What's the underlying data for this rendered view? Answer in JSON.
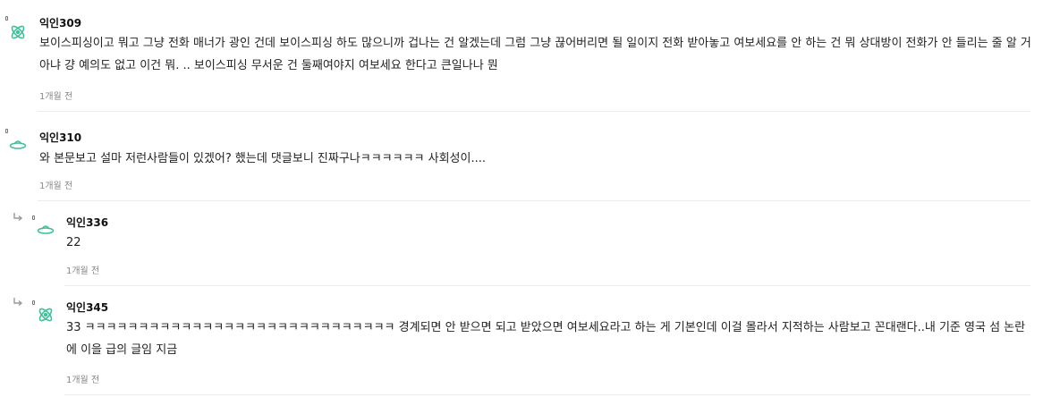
{
  "colors": {
    "accent": "#3fbf9b",
    "divider": "#ececec",
    "time": "#888888"
  },
  "comments": [
    {
      "author": "익인309",
      "icon": "atom-icon",
      "text": "보이스피싱이고 뭐고 그냥 전화 매너가 광인 건데 보이스피싱 하도 많으니까 겁나는 건 알겠는데 그럼 그냥 끊어버리면 될 일이지 전화 받아놓고 여보세요를 안 하는 건 뭐 상대방이 전화가 안 들리는 줄 알 거 아냐 걍 예의도 없고 이건 뭐. .. 보이스피싱 무서운 건 둘째여야지 여보세요 한다고 큰일나나 뭔",
      "time": "1개월 전"
    },
    {
      "author": "익인310",
      "icon": "ufo-icon",
      "text": "와 본문보고 설마 저런사람들이 있겠어? 했는데 댓글보니 진짜구나ㅋㅋㅋㅋㅋㅋ 사회성이....",
      "time": "1개월 전"
    },
    {
      "author": "익인336",
      "icon": "ufo-icon",
      "text": "22",
      "time": "1개월 전"
    },
    {
      "author": "익인345",
      "icon": "atom-icon",
      "text": "33 ㅋㅋㅋㅋㅋㅋㅋㅋㅋㅋㅋㅋㅋㅋㅋㅋㅋㅋㅋㅋㅋㅋㅋㅋㅋㅋㅋㅋㅋ 경계되면 안 받으면 되고 받았으면 여보세요라고 하는 게 기본인데 이걸 몰라서 지적하는 사람보고 꼰대랜다..내 기준 영국 섬 논란에 이을 급의 글임 지금",
      "time": "1개월 전"
    }
  ]
}
